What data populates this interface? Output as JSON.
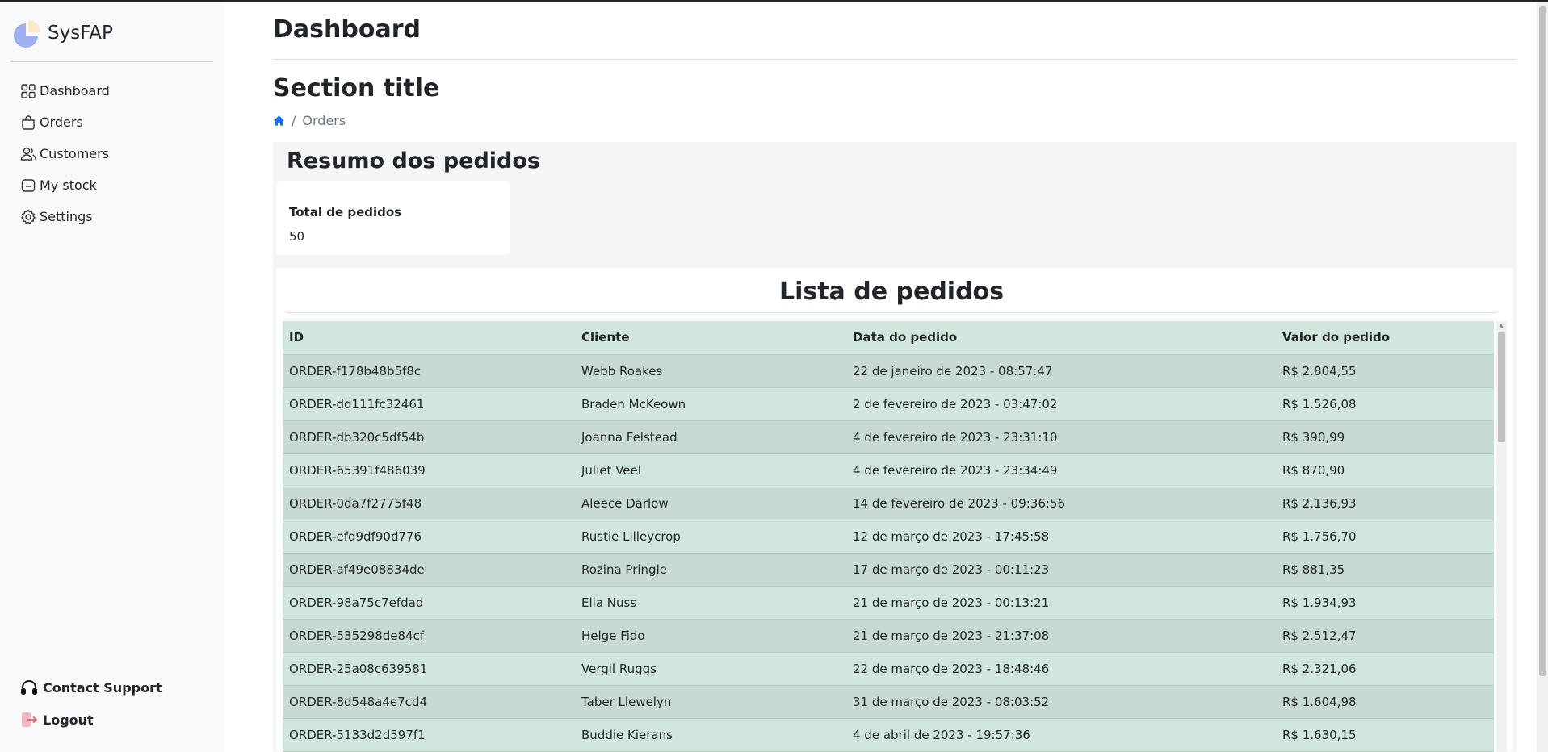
{
  "brand": {
    "name": "SysFAP"
  },
  "sidebar": {
    "items": [
      {
        "label": "Dashboard",
        "icon": "grid-icon"
      },
      {
        "label": "Orders",
        "icon": "bag-icon"
      },
      {
        "label": "Customers",
        "icon": "people-icon"
      },
      {
        "label": "My stock",
        "icon": "box-icon"
      },
      {
        "label": "Settings",
        "icon": "gear-icon"
      }
    ],
    "bottom": {
      "support_label": "Contact Support",
      "logout_label": "Logout"
    }
  },
  "header": {
    "title": "Dashboard"
  },
  "section": {
    "title": "Section title",
    "breadcrumb": {
      "current": "Orders"
    }
  },
  "summary": {
    "title": "Resumo dos pedidos",
    "card_label": "Total de pedidos",
    "card_value": "50"
  },
  "orders": {
    "title": "Lista de pedidos",
    "columns": [
      "ID",
      "Cliente",
      "Data do pedido",
      "Valor do pedido"
    ],
    "rows": [
      [
        "ORDER-f178b48b5f8c",
        "Webb Roakes",
        "22 de janeiro de 2023 - 08:57:47",
        "R$ 2.804,55"
      ],
      [
        "ORDER-dd111fc32461",
        "Braden McKeown",
        "2 de fevereiro de 2023 - 03:47:02",
        "R$ 1.526,08"
      ],
      [
        "ORDER-db320c5df54b",
        "Joanna Felstead",
        "4 de fevereiro de 2023 - 23:31:10",
        "R$ 390,99"
      ],
      [
        "ORDER-65391f486039",
        "Juliet Veel",
        "4 de fevereiro de 2023 - 23:34:49",
        "R$ 870,90"
      ],
      [
        "ORDER-0da7f2775f48",
        "Aleece Darlow",
        "14 de fevereiro de 2023 - 09:36:56",
        "R$ 2.136,93"
      ],
      [
        "ORDER-efd9df90d776",
        "Rustie Lilleycrop",
        "12 de março de 2023 - 17:45:58",
        "R$ 1.756,70"
      ],
      [
        "ORDER-af49e08834de",
        "Rozina Pringle",
        "17 de março de 2023 - 00:11:23",
        "R$ 881,35"
      ],
      [
        "ORDER-98a75c7efdad",
        "Elia Nuss",
        "21 de março de 2023 - 00:13:21",
        "R$ 1.934,93"
      ],
      [
        "ORDER-535298de84cf",
        "Helge Fido",
        "21 de março de 2023 - 21:37:08",
        "R$ 2.512,47"
      ],
      [
        "ORDER-25a08c639581",
        "Vergil Ruggs",
        "22 de março de 2023 - 18:48:46",
        "R$ 2.321,06"
      ],
      [
        "ORDER-8d548a4e7cd4",
        "Taber Llewelyn",
        "31 de março de 2023 - 08:03:52",
        "R$ 1.604,98"
      ],
      [
        "ORDER-5133d2d597f1",
        "Buddie Kierans",
        "4 de abril de 2023 - 19:57:36",
        "R$ 1.630,15"
      ]
    ]
  },
  "colors": {
    "row_even": "#d1e7dd",
    "row_odd": "#c7dbd2",
    "logout_icon": "#e35d6a",
    "home_icon": "#0d6efd"
  }
}
